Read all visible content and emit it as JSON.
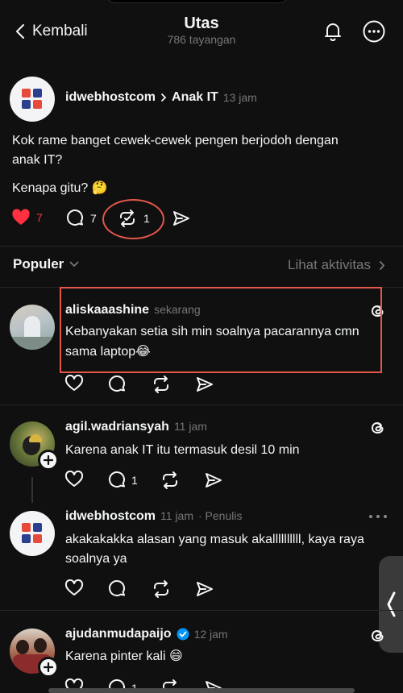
{
  "header": {
    "back_label": "Kembali",
    "title": "Utas",
    "views": "786 tayangan"
  },
  "main_post": {
    "author": "idwebhostcom",
    "topic": "Anak IT",
    "time": "13 jam",
    "text_line1": "Kok rame banget cewek-cewek pengen berjodoh dengan",
    "text_line2": "anak IT?",
    "text_line3": "Kenapa gitu? 🤔",
    "likes": "7",
    "replies": "7",
    "reposts": "1"
  },
  "sort": {
    "label": "Populer",
    "activity_link": "Lihat aktivitas"
  },
  "replies": [
    {
      "author": "aliskaaashine",
      "time": "sekarang",
      "line1": "Kebanyakan setia sih min soalnya pacarannya cmn",
      "line2": "sama laptop😂"
    },
    {
      "author": "agil.wadriansyah",
      "time": "11 jam",
      "line1": "Karena anak IT itu termasuk desil 10 min",
      "replies": "1"
    },
    {
      "author": "idwebhostcom",
      "time": "11 jam",
      "role": "· Penulis",
      "line1": "akakakakka alasan yang masuk akallllllllll, kaya raya",
      "line2": "soalnya ya"
    },
    {
      "author": "ajudanmudapaijo",
      "time": "12 jam",
      "line1": "Karena pinter kali 😄",
      "replies": "1"
    }
  ],
  "colors": {
    "background": "#101010",
    "highlight_red": "#e4574a",
    "heart_red": "#ff3040",
    "verified_blue": "#0095f6"
  }
}
